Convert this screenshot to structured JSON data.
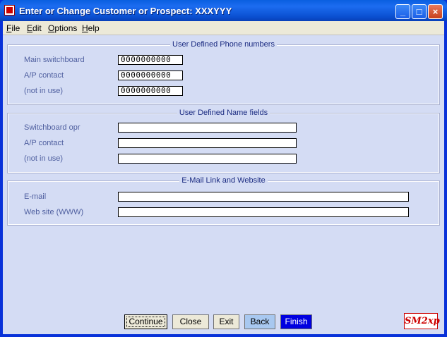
{
  "window": {
    "title": "Enter or Change Customer or Prospect:  XXXYYY"
  },
  "menu": [
    {
      "key": "F",
      "rest": "ile"
    },
    {
      "key": "E",
      "rest": "dit"
    },
    {
      "key": "O",
      "rest": "ptions"
    },
    {
      "key": "H",
      "rest": "elp"
    }
  ],
  "phone_group": {
    "title": "User Defined Phone numbers",
    "rows": [
      {
        "label": "Main switchboard",
        "value": "0000000000"
      },
      {
        "label": "A/P contact",
        "value": "0000000000"
      },
      {
        "label": "(not in use)",
        "value": "0000000000"
      }
    ]
  },
  "name_group": {
    "title": "User Defined Name fields",
    "rows": [
      {
        "label": "Switchboard opr",
        "value": ""
      },
      {
        "label": "A/P contact",
        "value": ""
      },
      {
        "label": "(not in use)",
        "value": ""
      }
    ]
  },
  "email_group": {
    "title": "E-Mail Link and Website",
    "rows": [
      {
        "label": "E-mail",
        "value": ""
      },
      {
        "label": "Web site (WWW)",
        "value": ""
      }
    ]
  },
  "buttons": {
    "continue": "Continue",
    "close": "Close",
    "exit": "Exit",
    "back": "Back",
    "finish": "Finish"
  },
  "logo_text": "SM2xp",
  "colors": {
    "title_bar": "#0a5fe0",
    "client_bg": "#d4dcf4",
    "finish_bg": "#0000e0",
    "back_bg": "#a8c8f0"
  }
}
